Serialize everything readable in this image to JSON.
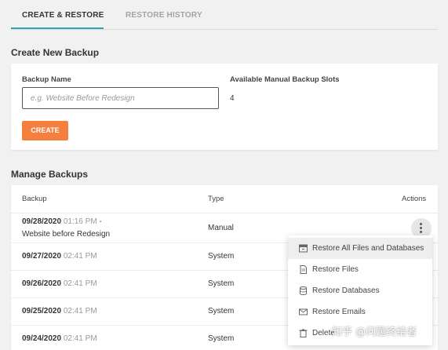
{
  "tabs": {
    "create_restore": "CREATE & RESTORE",
    "restore_history": "RESTORE HISTORY"
  },
  "create": {
    "title": "Create New Backup",
    "name_label": "Backup Name",
    "name_placeholder": "e.g. Website Before Redesign",
    "name_value": "",
    "slots_label": "Available Manual Backup Slots",
    "slots_value": "4",
    "create_button": "CREATE"
  },
  "manage": {
    "title": "Manage Backups",
    "headers": {
      "backup": "Backup",
      "type": "Type",
      "actions": "Actions"
    },
    "rows": [
      {
        "date": "09/28/2020",
        "time": "01:16 PM",
        "sep": " -",
        "name": "Website before Redesign",
        "type": "Manual"
      },
      {
        "date": "09/27/2020",
        "time": "02:41 PM",
        "type": "System"
      },
      {
        "date": "09/26/2020",
        "time": "02:41 PM",
        "type": "System"
      },
      {
        "date": "09/25/2020",
        "time": "02:41 PM",
        "type": "System"
      },
      {
        "date": "09/24/2020",
        "time": "02:41 PM",
        "type": "System"
      }
    ]
  },
  "menu": {
    "items": [
      {
        "label": "Restore All Files and Databases",
        "icon": "archive-icon"
      },
      {
        "label": "Restore Files",
        "icon": "file-icon"
      },
      {
        "label": "Restore Databases",
        "icon": "database-icon"
      },
      {
        "label": "Restore Emails",
        "icon": "envelope-icon"
      },
      {
        "label": "Delete",
        "icon": "trash-icon"
      }
    ]
  },
  "watermark": "知乎 @问题终结者",
  "colors": {
    "accent": "#2fa4b0",
    "create_button": "#f5803e"
  }
}
